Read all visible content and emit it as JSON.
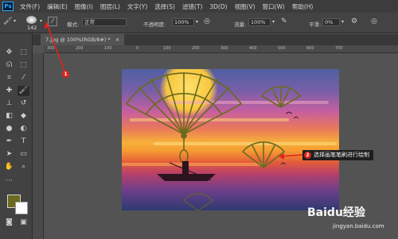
{
  "app": {
    "logo": "Ps"
  },
  "menu": [
    "文件(F)",
    "编辑(E)",
    "图像(I)",
    "图层(L)",
    "文字(Y)",
    "选择(S)",
    "滤镜(T)",
    "3D(D)",
    "视图(V)",
    "窗口(W)",
    "帮助(H)"
  ],
  "options": {
    "brush_size": "142",
    "mode_label": "模式:",
    "mode_value": "正常",
    "opacity_label": "不透明度:",
    "opacity_value": "100%",
    "flow_label": "流量:",
    "flow_value": "100%",
    "smoothing_label": "平滑:",
    "smoothing_value": "0%"
  },
  "document": {
    "tab_label": "7.jpg @ 100%(RGB/8#) *",
    "close": "×"
  },
  "ruler": {
    "top_ticks": [
      "300",
      "200",
      "100",
      "0",
      "100",
      "200",
      "300",
      "400",
      "500",
      "600",
      "700"
    ]
  },
  "toolbar": {
    "foreground_color": "#6b6a1e",
    "background_color": "#ffffff"
  },
  "annotations": {
    "callout_1": "1",
    "callout_2": "2",
    "tooltip_text": "选择画笔笔刷进行绘制",
    "accent_color": "#e2231a"
  },
  "watermark": {
    "brand": "Baidu经验",
    "url": "jingyan.baidu.com"
  }
}
